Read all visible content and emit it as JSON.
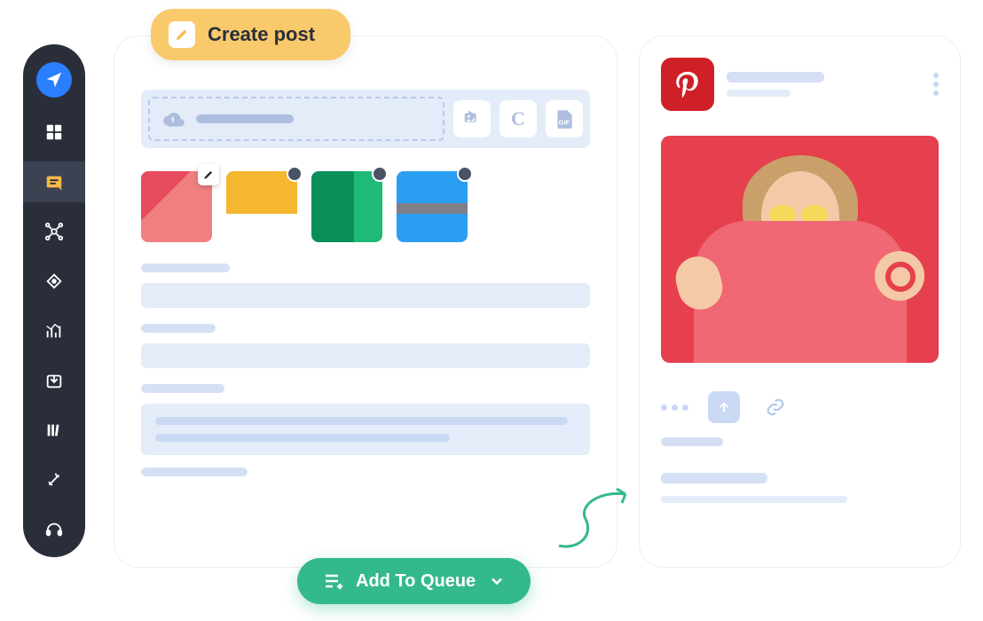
{
  "sidebar": {
    "items": [
      {
        "name": "logo-icon"
      },
      {
        "name": "dashboard-icon"
      },
      {
        "name": "compose-icon",
        "active": true
      },
      {
        "name": "network-icon"
      },
      {
        "name": "target-icon"
      },
      {
        "name": "analytics-icon"
      },
      {
        "name": "inbox-icon"
      },
      {
        "name": "library-icon"
      },
      {
        "name": "tools-icon"
      },
      {
        "name": "support-icon"
      }
    ]
  },
  "create_pill": {
    "label": "Create post"
  },
  "composer": {
    "upload": {
      "gif_label": "GIF",
      "canva_label": "C"
    },
    "thumbnails": [
      {
        "name": "thumbnail-1",
        "editable": true
      },
      {
        "name": "thumbnail-2"
      },
      {
        "name": "thumbnail-3"
      },
      {
        "name": "thumbnail-4"
      }
    ]
  },
  "queue_button": {
    "label": "Add To Queue"
  },
  "preview": {
    "platform": "pinterest"
  }
}
